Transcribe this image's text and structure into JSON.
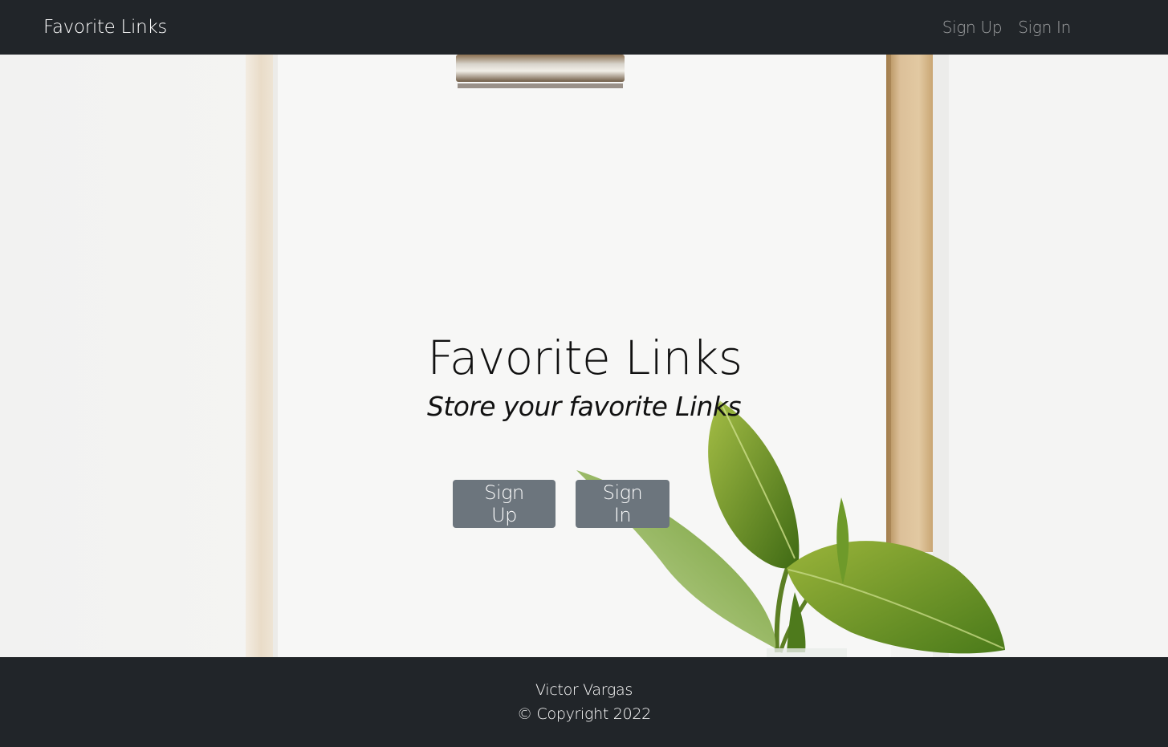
{
  "navbar": {
    "brand": "Favorite Links",
    "links": [
      "Sign Up",
      "Sign In"
    ]
  },
  "hero": {
    "title": "Favorite Links",
    "tagline": "Store your favorite Links",
    "buttons": [
      "Sign Up",
      "Sign In"
    ]
  },
  "footer": {
    "author": "Victor Vargas",
    "copyright": "© Copyright 2022"
  },
  "colors": {
    "navbar_bg": "#212529",
    "footer_bg": "#212529",
    "button_bg": "#6c757d",
    "nav_link": "rgba(255,255,255,0.55)"
  },
  "background_image": "clipboard-with-plant"
}
